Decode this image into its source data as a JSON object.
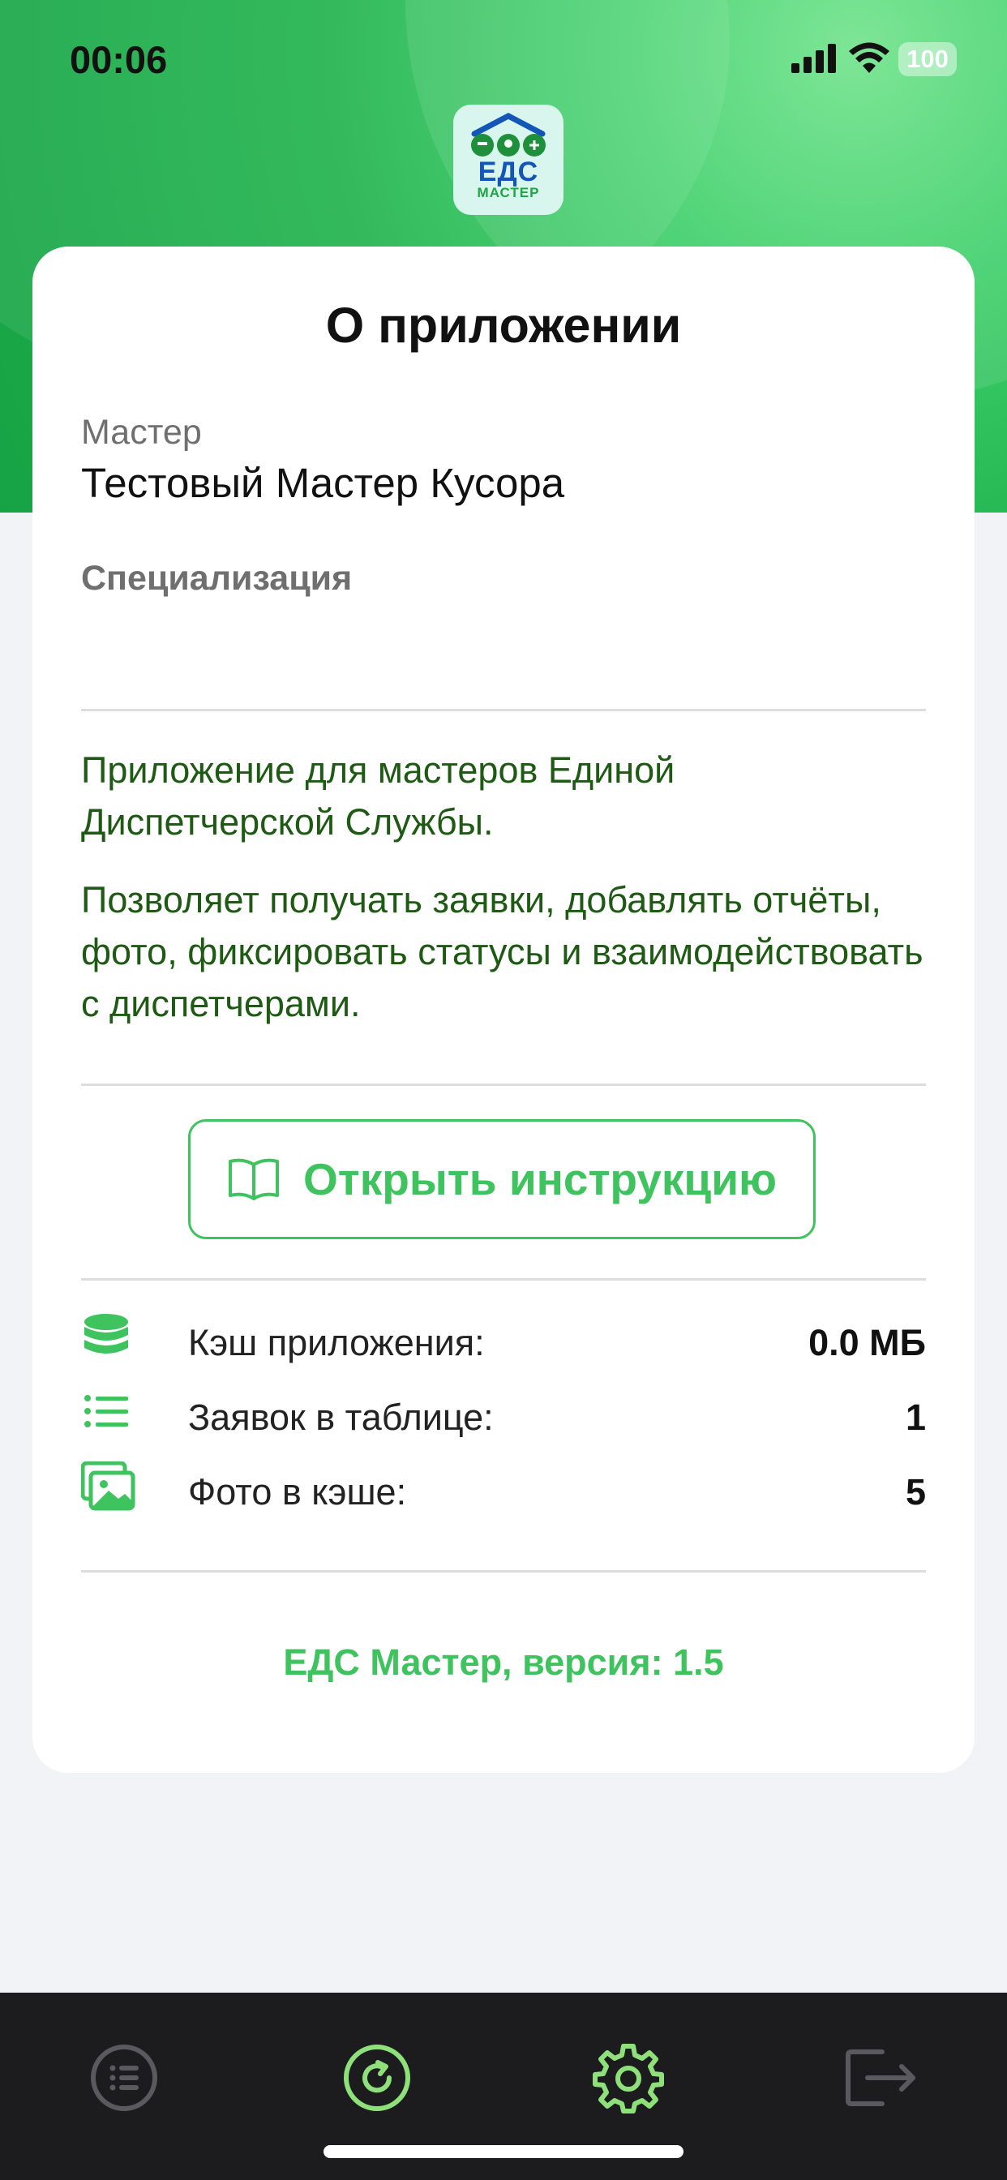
{
  "status_bar": {
    "time": "00:06",
    "battery": "100"
  },
  "logo": {
    "line1": "ЕДС",
    "line2": "МАСТЕР"
  },
  "card": {
    "title": "О приложении",
    "master_label": "Мастер",
    "master_name": "Тестовый Мастер Кусора",
    "specialization_label": "Специализация",
    "description_1": "Приложение для мастеров Единой Диспетчерской Службы.",
    "description_2": "Позволяет получать заявки, добавлять отчёты, фото, фиксировать статусы и взаимодействовать с диспетчерами.",
    "guide_button": "Открыть инструкцию",
    "stats": [
      {
        "label": "Кэш приложения:",
        "value": "0.0 МБ"
      },
      {
        "label": "Заявок в таблице:",
        "value": "1"
      },
      {
        "label": "Фото в кэше:",
        "value": "5"
      }
    ],
    "version": "ЕДС Мастер, версия: 1.5"
  },
  "tabbar": {
    "tabs": [
      "list-icon",
      "refresh-icon",
      "settings-icon",
      "logout-icon"
    ],
    "active": "settings-icon",
    "colors": {
      "inactive": "#5a5a5e",
      "active": "#8ee07a",
      "accent": "#3fc35e"
    }
  }
}
